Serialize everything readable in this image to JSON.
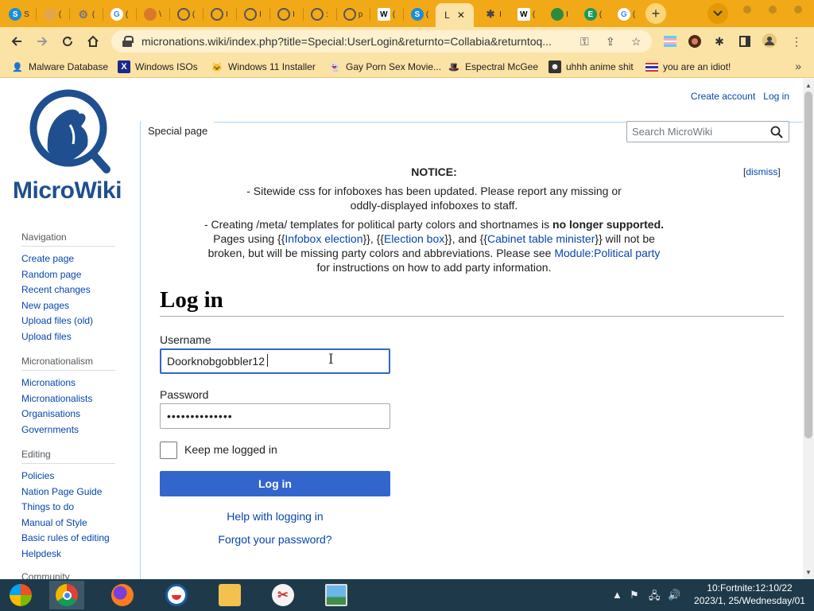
{
  "browser": {
    "tabs": [
      {
        "fav": "S",
        "color": "#1a8dd8",
        "label": "S"
      },
      {
        "fav": "img",
        "color": "#e3a54a",
        "label": "("
      },
      {
        "fav": "gear",
        "color": "#777777",
        "label": "("
      },
      {
        "fav": "G",
        "color": "#ffffff",
        "label": "("
      },
      {
        "fav": "img",
        "color": "#d97a2a",
        "label": "\\"
      },
      {
        "fav": "globe",
        "color": "#555555",
        "label": "("
      },
      {
        "fav": "globe",
        "color": "#555555",
        "label": "I"
      },
      {
        "fav": "globe",
        "color": "#555555",
        "label": "I"
      },
      {
        "fav": "globe",
        "color": "#555555",
        "label": "I"
      },
      {
        "fav": "globe",
        "color": "#555555",
        "label": ":"
      },
      {
        "fav": "globe",
        "color": "#555555",
        "label": "p"
      },
      {
        "fav": "W",
        "color": "#ffffff",
        "label": "("
      },
      {
        "fav": "S",
        "color": "#1a8dd8",
        "label": "("
      }
    ],
    "active_tab": {
      "title": "L",
      "close": "✕"
    },
    "tabs_right": [
      {
        "fav": "puzzle",
        "color": "#444444",
        "label": "I"
      },
      {
        "fav": "W",
        "color": "#ffffff",
        "label": "("
      },
      {
        "fav": "wm",
        "color": "#2e8b3d",
        "label": "I"
      },
      {
        "fav": "E",
        "color": "#1a9a5a",
        "label": "("
      },
      {
        "fav": "G",
        "color": "#ffffff",
        "label": "("
      }
    ],
    "new_tab": "+",
    "url": "micronations.wiki/index.php?title=Special:UserLogin&returnto=Collabia&returntoq...",
    "bookmarks": [
      {
        "label": "Malware Database",
        "icon": "person-icon"
      },
      {
        "label": "Windows ISOs",
        "icon": "x-icon"
      },
      {
        "label": "Windows 11 Installer",
        "icon": "cat-icon"
      },
      {
        "label": "Gay Porn Sex Movie...",
        "icon": "ghost-icon"
      },
      {
        "label": "Espectral McGee",
        "icon": "hat-icon"
      },
      {
        "label": "uhhh anime shit",
        "icon": "face-icon"
      },
      {
        "label": "you are an idiot!",
        "icon": "flag-icon"
      }
    ],
    "bookmarks_more": "»"
  },
  "wiki": {
    "logo_text": "MicroWiki",
    "personal": {
      "create_account": "Create account",
      "log_in": "Log in"
    },
    "tab_special": "Special page",
    "search_placeholder": "Search MicroWiki",
    "sidebar": [
      {
        "heading": "Navigation",
        "links": [
          "Create page",
          "Random page",
          "Recent changes",
          "New pages",
          "Upload files (old)",
          "Upload files"
        ]
      },
      {
        "heading": "Micronationalism",
        "links": [
          "Micronations",
          "Micronationalists",
          "Organisations",
          "Governments"
        ]
      },
      {
        "heading": "Editing",
        "links": [
          "Policies",
          "Nation Page Guide",
          "Things to do",
          "Manual of Style",
          "Basic rules of editing",
          "Helpdesk"
        ]
      },
      {
        "heading": "Community",
        "links": []
      }
    ],
    "notice": {
      "title": "NOTICE:",
      "line1": "- Sitewide css for infoboxes has been updated. Please report any missing or oddly-displayed infoboxes to staff.",
      "line2_a": "- Creating /meta/ templates for political party colors and shortnames is ",
      "line2_bold": "no longer supported.",
      "line2_b": " Pages using {{",
      "link_infobox": "Infobox election",
      "line2_c": "}}, {{",
      "link_election_box": "Election box",
      "line2_d": "}}, and {{",
      "link_cabinet": "Cabinet table minister",
      "line2_e": "}} will not be broken, but will be missing party colors and abbreviations. Please see ",
      "link_module": "Module:Political party",
      "line2_f": " for instructions on how to add party information.",
      "dismiss_open": "[",
      "dismiss": "dismiss",
      "dismiss_close": "]"
    },
    "heading": "Log in",
    "form": {
      "username_label": "Username",
      "username_value": "Doorknobgobbler12",
      "password_label": "Password",
      "password_value": "••••••••••••••",
      "keep_logged_in": "Keep me logged in",
      "login_button": "Log in",
      "help_link": "Help with logging in",
      "forgot_link": "Forgot your password?"
    }
  },
  "taskbar": {
    "clock_line1": "10:Fortnite:12:10/22",
    "clock_line2": "2023/1, 25/Wednesday/01"
  },
  "colors": {
    "tabstrip": "#f2a918",
    "toolbar": "#fbe3a6",
    "link": "#0645ad",
    "button": "#3366cc",
    "taskbar": "#1e3a4a"
  }
}
